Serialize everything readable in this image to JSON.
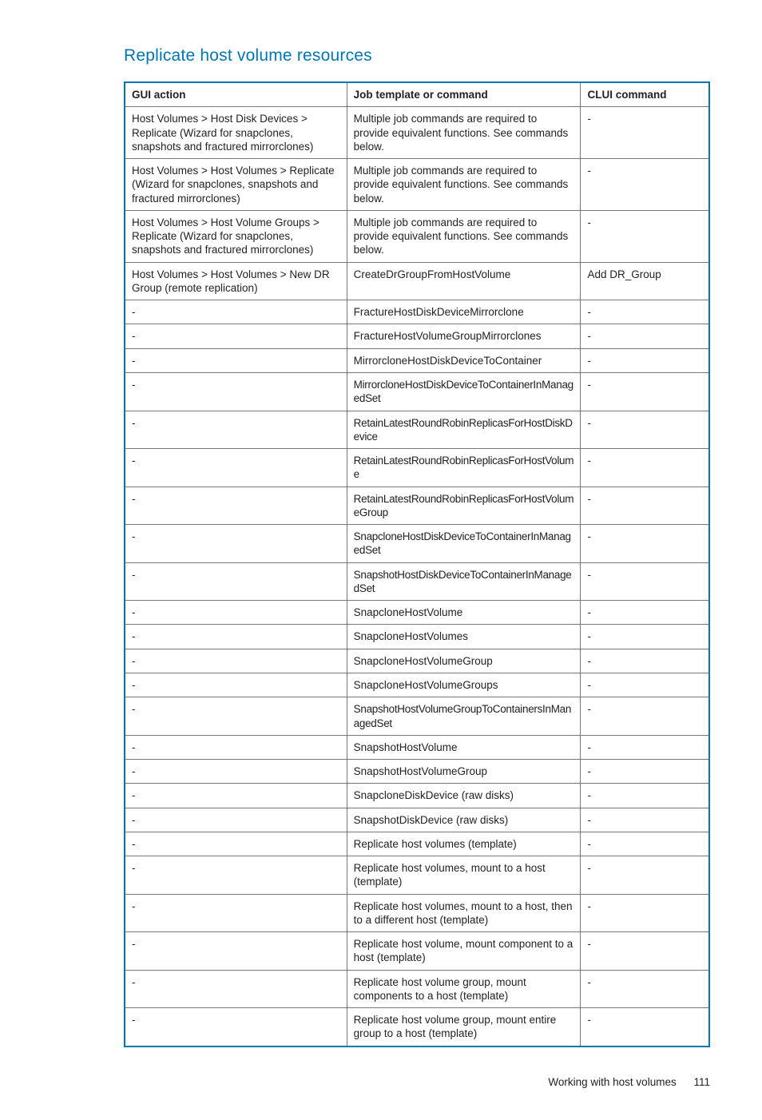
{
  "section_title": "Replicate host volume resources",
  "columns": [
    "GUI action",
    "Job template or command",
    "CLUI command"
  ],
  "rows": [
    {
      "gui": "Host Volumes > Host Disk Devices > Replicate (Wizard for snapclones, snapshots and fractured mirrorclones)",
      "job": "Multiple job commands are required to provide equivalent functions. See commands below.",
      "clui": "-"
    },
    {
      "gui": "Host Volumes > Host Volumes > Replicate (Wizard for snapclones, snapshots and fractured mirrorclones)",
      "job": "Multiple job commands are required to provide equivalent functions. See commands below.",
      "clui": "-"
    },
    {
      "gui": "Host Volumes > Host Volume Groups > Replicate (Wizard for snapclones, snapshots and fractured mirrorclones)",
      "job": "Multiple job commands are required to provide equivalent functions. See commands below.",
      "clui": "-"
    },
    {
      "gui": "Host Volumes > Host Volumes > New DR Group (remote replication)",
      "job": "CreateDrGroupFromHostVolume",
      "clui": "Add DR_Group"
    },
    {
      "gui": "-",
      "job": "FractureHostDiskDeviceMirrorclone",
      "clui": "-"
    },
    {
      "gui": "-",
      "job": "FractureHostVolumeGroupMirrorclones",
      "clui": "-"
    },
    {
      "gui": "-",
      "job": "MirrorcloneHostDiskDeviceToContainer",
      "clui": "-"
    },
    {
      "gui": "-",
      "job": "MirrorcloneHostDiskDeviceToContainerInManagedSet",
      "clui": "-",
      "narrow": true
    },
    {
      "gui": "-",
      "job": "RetainLatestRoundRobinReplicasForHostDiskDevice",
      "clui": "-",
      "narrow": true
    },
    {
      "gui": "-",
      "job": "RetainLatestRoundRobinReplicasForHostVolume",
      "clui": "-",
      "narrow": true
    },
    {
      "gui": "-",
      "job": "RetainLatestRoundRobinReplicasForHostVolumeGroup",
      "clui": "-",
      "narrow": true
    },
    {
      "gui": "-",
      "job": "SnapcloneHostDiskDeviceToContainerInManagedSet",
      "clui": "-",
      "narrow": true
    },
    {
      "gui": "-",
      "job": "SnapshotHostDiskDeviceToContainerInManagedSet",
      "clui": "-",
      "narrow": true
    },
    {
      "gui": "-",
      "job": "SnapcloneHostVolume",
      "clui": "-"
    },
    {
      "gui": "-",
      "job": "SnapcloneHostVolumes",
      "clui": "-"
    },
    {
      "gui": "-",
      "job": "SnapcloneHostVolumeGroup",
      "clui": "-"
    },
    {
      "gui": "-",
      "job": "SnapcloneHostVolumeGroups",
      "clui": "-"
    },
    {
      "gui": "-",
      "job": "SnapshotHostVolumeGroupToContainersInManagedSet",
      "clui": "-",
      "narrow": true
    },
    {
      "gui": "-",
      "job": "SnapshotHostVolume",
      "clui": "-"
    },
    {
      "gui": "-",
      "job": "SnapshotHostVolumeGroup",
      "clui": "-"
    },
    {
      "gui": "-",
      "job": "SnapcloneDiskDevice (raw disks)",
      "clui": "-"
    },
    {
      "gui": "-",
      "job": "SnapshotDiskDevice (raw disks)",
      "clui": "-"
    },
    {
      "gui": "-",
      "job": "Replicate host volumes (template)",
      "clui": "-"
    },
    {
      "gui": "-",
      "job": "Replicate host volumes, mount to a host (template)",
      "clui": "-"
    },
    {
      "gui": "-",
      "job": "Replicate host volumes, mount to a host, then to a different host (template)",
      "clui": "-"
    },
    {
      "gui": "-",
      "job": "Replicate host volume, mount component to a host (template)",
      "clui": "-"
    },
    {
      "gui": "-",
      "job": "Replicate host volume group, mount components to a host (template)",
      "clui": "-"
    },
    {
      "gui": "-",
      "job": "Replicate host volume group, mount entire group to a host (template)",
      "clui": "-"
    }
  ],
  "footer": {
    "text": "Working with host volumes",
    "page": "111"
  }
}
